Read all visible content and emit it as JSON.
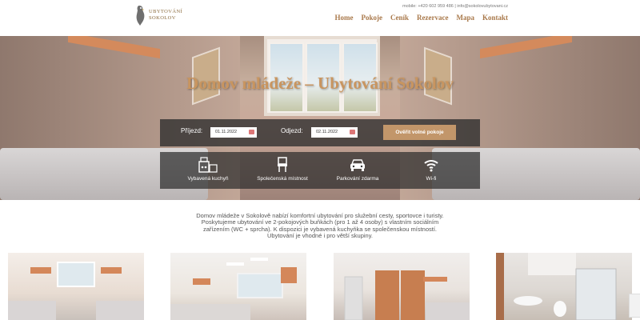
{
  "header": {
    "brand_line1": "UBYTOVÁNÍ",
    "brand_line2": "SOKOLOV",
    "contact": "mobile: +420 602 959 486 | info@sokolovubytovani.cz",
    "nav": [
      "Home",
      "Pokoje",
      "Ceník",
      "Rezervace",
      "Mapa",
      "Kontakt"
    ]
  },
  "hero": {
    "title": "Domov mládeže – Ubytování Sokolov"
  },
  "booking": {
    "arrival_label": "Příjezd:",
    "arrival_value": "01.11.2022",
    "departure_label": "Odjezd:",
    "departure_value": "02.11.2022",
    "button_label": "Ověřit volné pokoje"
  },
  "amenities": [
    {
      "label": "Vybavená kuchyň",
      "icon": "kitchen-icon"
    },
    {
      "label": "Společenská místnost",
      "icon": "chair-icon"
    },
    {
      "label": "Parkování zdarma",
      "icon": "car-icon"
    },
    {
      "label": "Wi-fi",
      "icon": "wifi-icon"
    }
  ],
  "intro": {
    "line1": "Domov mládeže v Sokolově nabízí komfortní ubytování pro služební cesty, sportovce i turisty.",
    "line2": "Poskytujeme ubytování ve 2-pokojových buňkách (pro 1 až 4 osoby) s vlastním sociálním",
    "line3": "zařízením (WC + sprcha). K dispozici je vybavená kuchyňka se společenskou místností.",
    "line4": "Ubytování je vhodné i pro větší skupiny."
  },
  "colors": {
    "accent": "#c2966a",
    "title": "#c9955f",
    "nav": "#a9794b"
  }
}
